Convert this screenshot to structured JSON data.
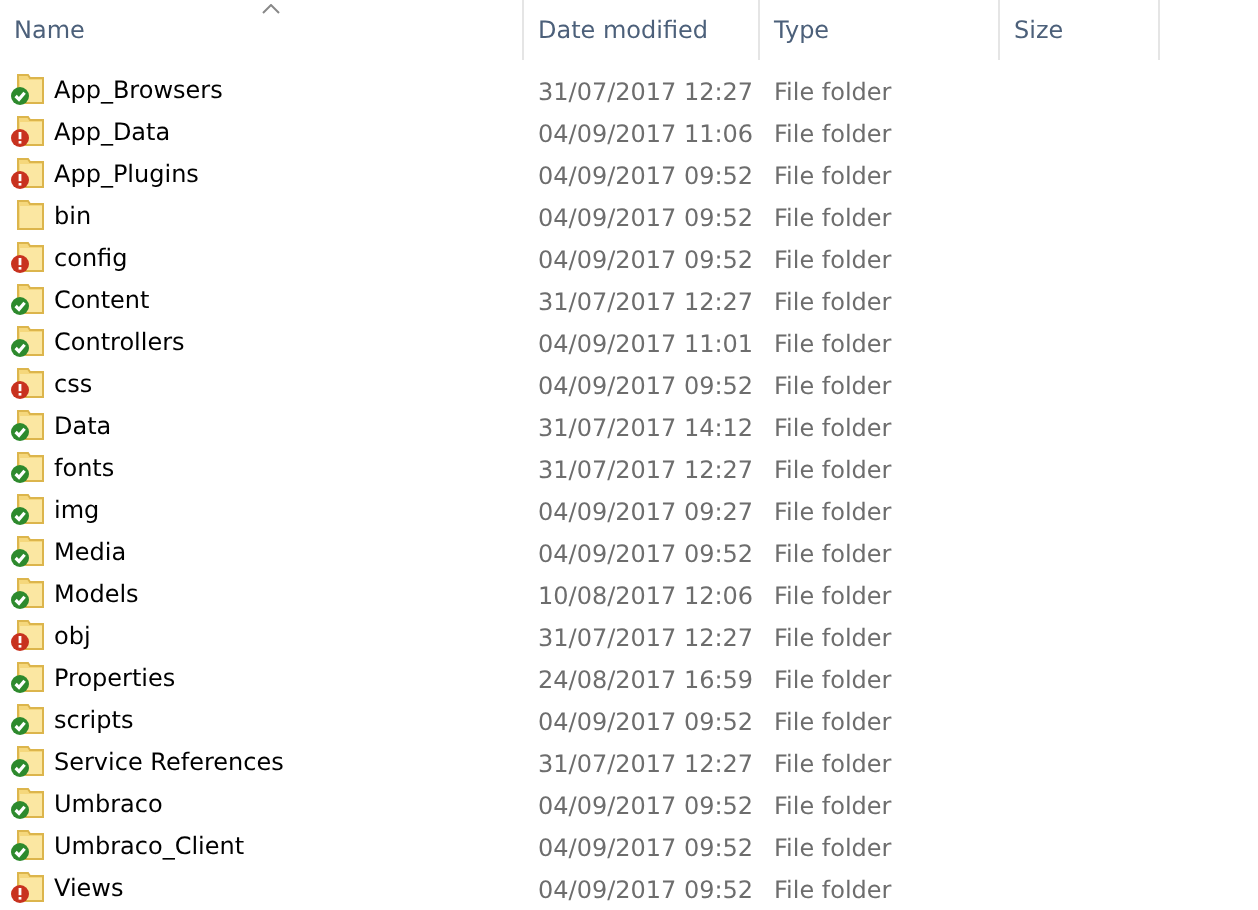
{
  "columns": [
    {
      "label": "Name",
      "sorted": true
    },
    {
      "label": "Date modified",
      "sorted": false
    },
    {
      "label": "Type",
      "sorted": false
    },
    {
      "label": "Size",
      "sorted": false
    }
  ],
  "rows": [
    {
      "name": "App_Browsers",
      "kind": "ok",
      "date": "31/07/2017 12:27",
      "type": "File folder"
    },
    {
      "name": "App_Data",
      "kind": "modified",
      "date": "04/09/2017 11:06",
      "type": "File folder"
    },
    {
      "name": "App_Plugins",
      "kind": "modified",
      "date": "04/09/2017 09:52",
      "type": "File folder"
    },
    {
      "name": "bin",
      "kind": "none",
      "date": "04/09/2017 09:52",
      "type": "File folder"
    },
    {
      "name": "config",
      "kind": "modified",
      "date": "04/09/2017 09:52",
      "type": "File folder"
    },
    {
      "name": "Content",
      "kind": "ok",
      "date": "31/07/2017 12:27",
      "type": "File folder"
    },
    {
      "name": "Controllers",
      "kind": "ok",
      "date": "04/09/2017 11:01",
      "type": "File folder"
    },
    {
      "name": "css",
      "kind": "modified",
      "date": "04/09/2017 09:52",
      "type": "File folder"
    },
    {
      "name": "Data",
      "kind": "ok",
      "date": "31/07/2017 14:12",
      "type": "File folder"
    },
    {
      "name": "fonts",
      "kind": "ok",
      "date": "31/07/2017 12:27",
      "type": "File folder"
    },
    {
      "name": "img",
      "kind": "ok",
      "date": "04/09/2017 09:27",
      "type": "File folder"
    },
    {
      "name": "Media",
      "kind": "ok",
      "date": "04/09/2017 09:52",
      "type": "File folder"
    },
    {
      "name": "Models",
      "kind": "ok",
      "date": "10/08/2017 12:06",
      "type": "File folder"
    },
    {
      "name": "obj",
      "kind": "modified",
      "date": "31/07/2017 12:27",
      "type": "File folder"
    },
    {
      "name": "Properties",
      "kind": "ok",
      "date": "24/08/2017 16:59",
      "type": "File folder"
    },
    {
      "name": "scripts",
      "kind": "ok",
      "date": "04/09/2017 09:52",
      "type": "File folder"
    },
    {
      "name": "Service References",
      "kind": "ok",
      "date": "31/07/2017 12:27",
      "type": "File folder"
    },
    {
      "name": "Umbraco",
      "kind": "ok",
      "date": "04/09/2017 09:52",
      "type": "File folder"
    },
    {
      "name": "Umbraco_Client",
      "kind": "ok",
      "date": "04/09/2017 09:52",
      "type": "File folder"
    },
    {
      "name": "Views",
      "kind": "modified",
      "date": "04/09/2017 09:52",
      "type": "File folder"
    }
  ]
}
